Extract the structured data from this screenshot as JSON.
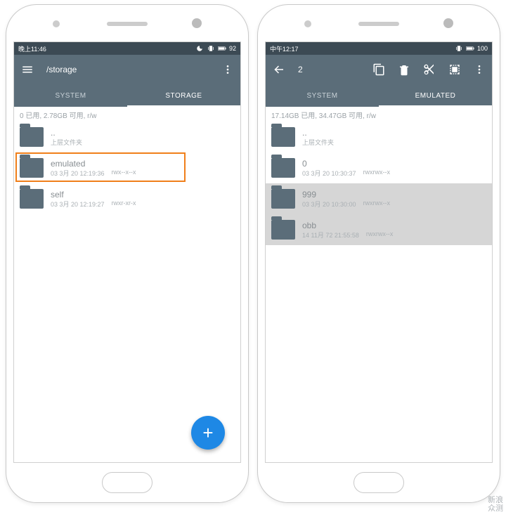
{
  "watermark": {
    "line1": "新浪",
    "line2": "众测"
  },
  "left": {
    "status": {
      "time": "晚上11:46",
      "battery": "92"
    },
    "appbar": {
      "path": "/storage"
    },
    "tabs": {
      "t1": "SYSTEM",
      "t2": "STORAGE"
    },
    "storage_line": "0 已用, 2.78GB 可用, r/w",
    "rows": [
      {
        "name": "..",
        "sub": "上层文件夹",
        "perm": ""
      },
      {
        "name": "emulated",
        "sub": "03 3月 20 12:19:36",
        "perm": "rwx--x--x"
      },
      {
        "name": "self",
        "sub": "03 3月 20 12:19:27",
        "perm": "rwxr-xr-x"
      }
    ],
    "fab": "+"
  },
  "right": {
    "status": {
      "time": "中午12:17",
      "battery": "100"
    },
    "appbar": {
      "count": "2"
    },
    "tabs": {
      "t1": "SYSTEM",
      "t2": "EMULATED"
    },
    "storage_line": "17.14GB 已用, 34.47GB 可用, r/w",
    "rows": [
      {
        "name": "..",
        "sub": "上层文件夹",
        "perm": ""
      },
      {
        "name": "0",
        "sub": "03 3月 20 10:30:37",
        "perm": "rwxrwx--x"
      },
      {
        "name": "999",
        "sub": "03 3月 20 10:30:00",
        "perm": "rwxrwx--x"
      },
      {
        "name": "obb",
        "sub": "14 11月 72 21:55:58",
        "perm": "rwxrwx--x"
      }
    ]
  }
}
